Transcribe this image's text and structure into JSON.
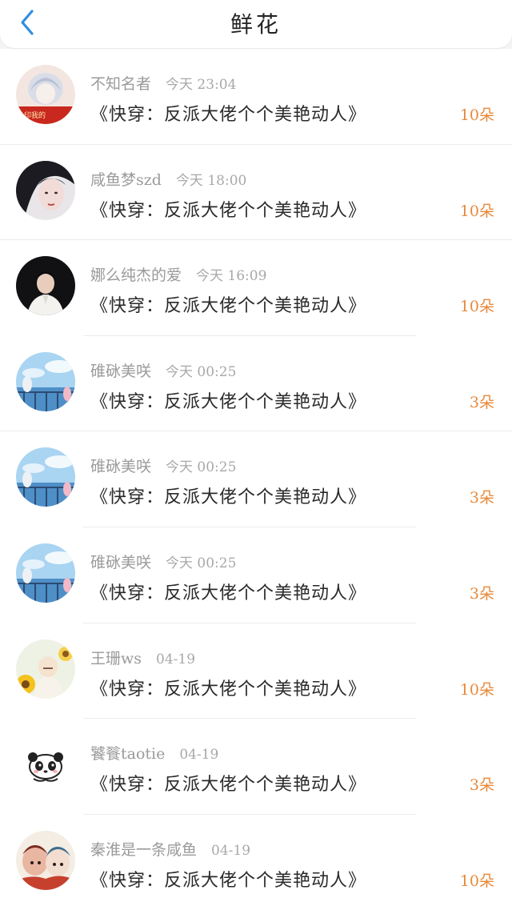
{
  "header": {
    "title": "鲜花"
  },
  "colors": {
    "accent_count": "#e8893a",
    "back_arrow": "#2f8fe0"
  },
  "items": [
    {
      "name": "不知名者",
      "time": "今天 23:04",
      "book": "《快穿：反派大佬个个美艳动人》",
      "count": "10朵",
      "avatar": "avatar-anime-illustration"
    },
    {
      "name": "咸鱼梦szd",
      "time": "今天 18:00",
      "book": "《快穿：反派大佬个个美艳动人》",
      "count": "10朵",
      "avatar": "avatar-dark-hair-portrait"
    },
    {
      "name": "娜么纯杰的爱",
      "time": "今天 16:09",
      "book": "《快穿：反派大佬个个美艳动人》",
      "count": "10朵",
      "avatar": "avatar-white-suit-portrait"
    },
    {
      "name": "碓砯美咲",
      "time": "今天 00:25",
      "book": "《快穿：反派大佬个个美艳动人》",
      "count": "3朵",
      "avatar": "avatar-sky-scene"
    },
    {
      "name": "碓砯美咲",
      "time": "今天 00:25",
      "book": "《快穿：反派大佬个个美艳动人》",
      "count": "3朵",
      "avatar": "avatar-sky-scene"
    },
    {
      "name": "碓砯美咲",
      "time": "今天 00:25",
      "book": "《快穿：反派大佬个个美艳动人》",
      "count": "3朵",
      "avatar": "avatar-sky-scene"
    },
    {
      "name": "王珊ws",
      "time": "04-19",
      "book": "《快穿：反派大佬个个美艳动人》",
      "count": "10朵",
      "avatar": "avatar-sunflower-anime"
    },
    {
      "name": "饕餮taotie",
      "time": "04-19",
      "book": "《快穿：反派大佬个个美艳动人》",
      "count": "3朵",
      "avatar": "avatar-panda-cartoon"
    },
    {
      "name": "秦淮是一条咸鱼",
      "time": "04-19",
      "book": "《快穿：反派大佬个个美艳动人》",
      "count": "10朵",
      "avatar": "avatar-colorful-cartoon"
    }
  ]
}
